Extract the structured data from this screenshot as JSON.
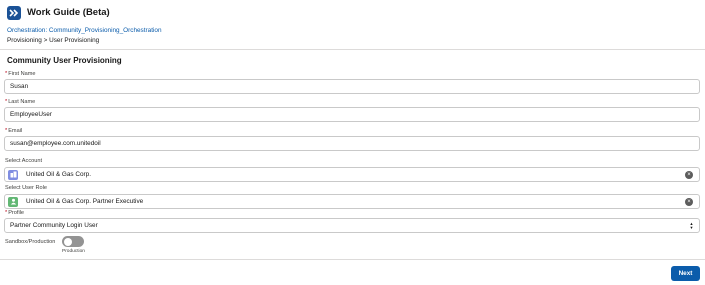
{
  "header": {
    "app_title": "Work Guide (Beta)",
    "orchestration_link": "Orchestration: Community_Provisioning_Orchestration",
    "breadcrumb": "Provisioning > User Provisioning",
    "icon": "double-chevron-right-icon",
    "icon_color": "#1b5297"
  },
  "form": {
    "section_title": "Community User Provisioning",
    "required_marker": "*",
    "first_name": {
      "label": "First Name",
      "value": "Susan",
      "required": true
    },
    "last_name": {
      "label": "Last Name",
      "value": "EmployeeUser",
      "required": true
    },
    "email": {
      "label": "Email",
      "value": "susan@employee.com.unitedoil",
      "required": true
    },
    "account": {
      "label": "Select Account",
      "value": "United Oil & Gas Corp.",
      "icon": "account-icon",
      "icon_color": "#7f8de1"
    },
    "user_role": {
      "label": "Select User Role",
      "value": "United Oil & Gas Corp. Partner Executive",
      "icon": "user-role-icon",
      "icon_color": "#62b774"
    },
    "profile": {
      "label": "Profile",
      "value": "Partner Community Login User",
      "required": true
    },
    "sandbox_toggle": {
      "label": "Sandbox/Production",
      "state_text": "Production",
      "checked": false
    }
  },
  "footer": {
    "next_label": "Next",
    "accent_color": "#0b5cab"
  }
}
